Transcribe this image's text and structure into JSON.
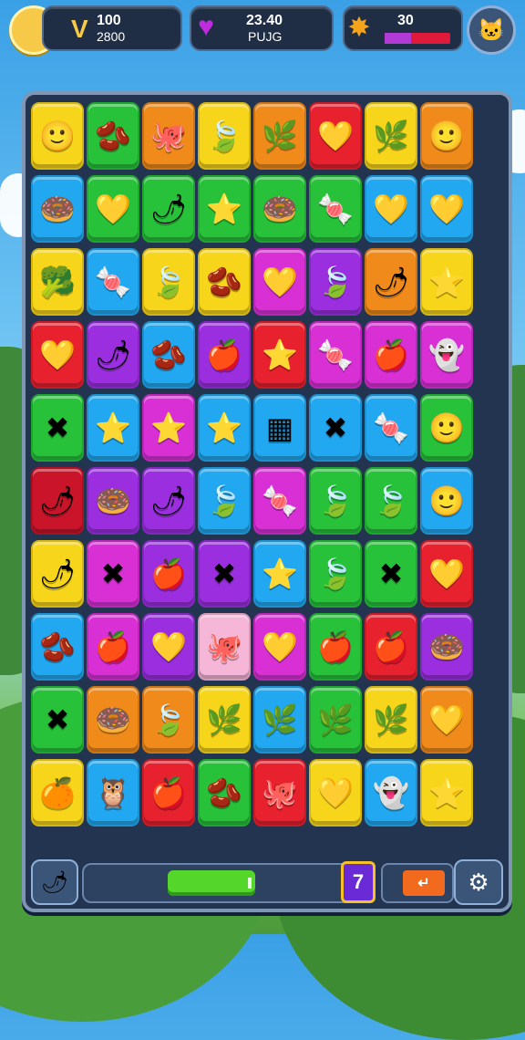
{
  "hud": {
    "coins": {
      "letter": "V",
      "line1": "100",
      "line2": "2800"
    },
    "lives": {
      "line1": "23.40",
      "line2": "PUJG"
    },
    "energy": {
      "line1": "30",
      "bar_fill_percent": 40
    }
  },
  "board": {
    "rows": [
      [
        {
          "icon": "face",
          "c": "#f7d51b"
        },
        {
          "icon": "bean",
          "c": "#27c23a"
        },
        {
          "icon": "octopus",
          "c": "#f08a1a"
        },
        {
          "icon": "leaf",
          "c": "#f7d51b"
        },
        {
          "icon": "sprout",
          "c": "#f08a1a"
        },
        {
          "icon": "heart",
          "c": "#e8212f"
        },
        {
          "icon": "sprout",
          "c": "#f7d51b"
        },
        {
          "icon": "face",
          "c": "#f08a1a"
        }
      ],
      [
        {
          "icon": "ring",
          "c": "#21a8f0"
        },
        {
          "icon": "heart",
          "c": "#27c23a"
        },
        {
          "icon": "pepper",
          "c": "#27c23a"
        },
        {
          "icon": "star",
          "c": "#27c23a"
        },
        {
          "icon": "ring",
          "c": "#27c23a"
        },
        {
          "icon": "candy",
          "c": "#27c23a"
        },
        {
          "icon": "heart",
          "c": "#21a8f0"
        },
        {
          "icon": "heart",
          "c": "#21a8f0"
        }
      ],
      [
        {
          "icon": "bush",
          "c": "#f7d51b"
        },
        {
          "icon": "candy",
          "c": "#21a8f0"
        },
        {
          "icon": "leaf",
          "c": "#f7d51b"
        },
        {
          "icon": "bean",
          "c": "#f7d51b"
        },
        {
          "icon": "heart",
          "c": "#d930d6"
        },
        {
          "icon": "leaf",
          "c": "#9b2fe0"
        },
        {
          "icon": "pepper",
          "c": "#f08a1a"
        },
        {
          "icon": "star",
          "c": "#f7d51b"
        }
      ],
      [
        {
          "icon": "heart",
          "c": "#e8212f"
        },
        {
          "icon": "pepper",
          "c": "#9b2fe0"
        },
        {
          "icon": "bean",
          "c": "#21a8f0"
        },
        {
          "icon": "apple",
          "c": "#9b2fe0"
        },
        {
          "icon": "star",
          "c": "#e8212f"
        },
        {
          "icon": "candy",
          "c": "#d930d6"
        },
        {
          "icon": "apple",
          "c": "#d930d6"
        },
        {
          "icon": "ghost",
          "c": "#d930d6"
        }
      ],
      [
        {
          "icon": "cross",
          "c": "#27c23a"
        },
        {
          "icon": "star",
          "c": "#21a8f0"
        },
        {
          "icon": "star",
          "c": "#d930d6"
        },
        {
          "icon": "star",
          "c": "#21a8f0"
        },
        {
          "icon": "grid",
          "c": "#21a8f0"
        },
        {
          "icon": "cross",
          "c": "#21a8f0"
        },
        {
          "icon": "candy",
          "c": "#21a8f0"
        },
        {
          "icon": "face",
          "c": "#27c23a"
        }
      ],
      [
        {
          "icon": "pepper",
          "c": "#c9142a"
        },
        {
          "icon": "ring",
          "c": "#9b2fe0"
        },
        {
          "icon": "pepper",
          "c": "#9b2fe0"
        },
        {
          "icon": "leaf",
          "c": "#21a8f0"
        },
        {
          "icon": "candy",
          "c": "#d930d6"
        },
        {
          "icon": "leaf",
          "c": "#27c23a"
        },
        {
          "icon": "leaf",
          "c": "#27c23a"
        },
        {
          "icon": "face",
          "c": "#21a8f0"
        }
      ],
      [
        {
          "icon": "pepper",
          "c": "#f7d51b"
        },
        {
          "icon": "cross",
          "c": "#d930d6"
        },
        {
          "icon": "apple",
          "c": "#9b2fe0"
        },
        {
          "icon": "cross",
          "c": "#9b2fe0"
        },
        {
          "icon": "star",
          "c": "#21a8f0"
        },
        {
          "icon": "leaf",
          "c": "#27c23a"
        },
        {
          "icon": "cross",
          "c": "#27c23a"
        },
        {
          "icon": "heart",
          "c": "#e8212f"
        }
      ],
      [
        {
          "icon": "bean",
          "c": "#21a8f0"
        },
        {
          "icon": "apple",
          "c": "#d930d6"
        },
        {
          "icon": "heart",
          "c": "#9b2fe0"
        },
        {
          "icon": "octopus",
          "c": "#f6b6d8"
        },
        {
          "icon": "heart",
          "c": "#d930d6"
        },
        {
          "icon": "apple",
          "c": "#27c23a"
        },
        {
          "icon": "apple",
          "c": "#e8212f"
        },
        {
          "icon": "ring",
          "c": "#9b2fe0"
        }
      ],
      [
        {
          "icon": "cross",
          "c": "#27c23a"
        },
        {
          "icon": "ring",
          "c": "#f08a1a"
        },
        {
          "icon": "leaf",
          "c": "#f08a1a"
        },
        {
          "icon": "sprout",
          "c": "#f7d51b"
        },
        {
          "icon": "sprout",
          "c": "#21a8f0"
        },
        {
          "icon": "sprout",
          "c": "#27c23a"
        },
        {
          "icon": "sprout",
          "c": "#f7d51b"
        },
        {
          "icon": "heart",
          "c": "#f08a1a"
        }
      ],
      [
        {
          "icon": "orange",
          "c": "#f7d51b"
        },
        {
          "icon": "owl",
          "c": "#21a8f0"
        },
        {
          "icon": "apple",
          "c": "#e8212f"
        },
        {
          "icon": "bean",
          "c": "#27c23a"
        },
        {
          "icon": "octopus",
          "c": "#e8212f"
        },
        {
          "icon": "heart",
          "c": "#f7d51b"
        },
        {
          "icon": "ghost",
          "c": "#21a8f0"
        },
        {
          "icon": "star",
          "c": "#f7d51b"
        }
      ]
    ]
  },
  "bottom": {
    "progress_percent": 55,
    "moves": "7"
  },
  "glyphs": {
    "face": "🙂",
    "bean": "🫘",
    "octopus": "🐙",
    "leaf": "🍃",
    "sprout": "🌿",
    "heart": "💛",
    "ring": "🍩",
    "pepper": "🌶",
    "star": "⭐",
    "candy": "🍬",
    "bush": "🥦",
    "apple": "🍎",
    "ghost": "👻",
    "cross": "✖",
    "grid": "▦",
    "orange": "🍊",
    "owl": "🦉"
  }
}
